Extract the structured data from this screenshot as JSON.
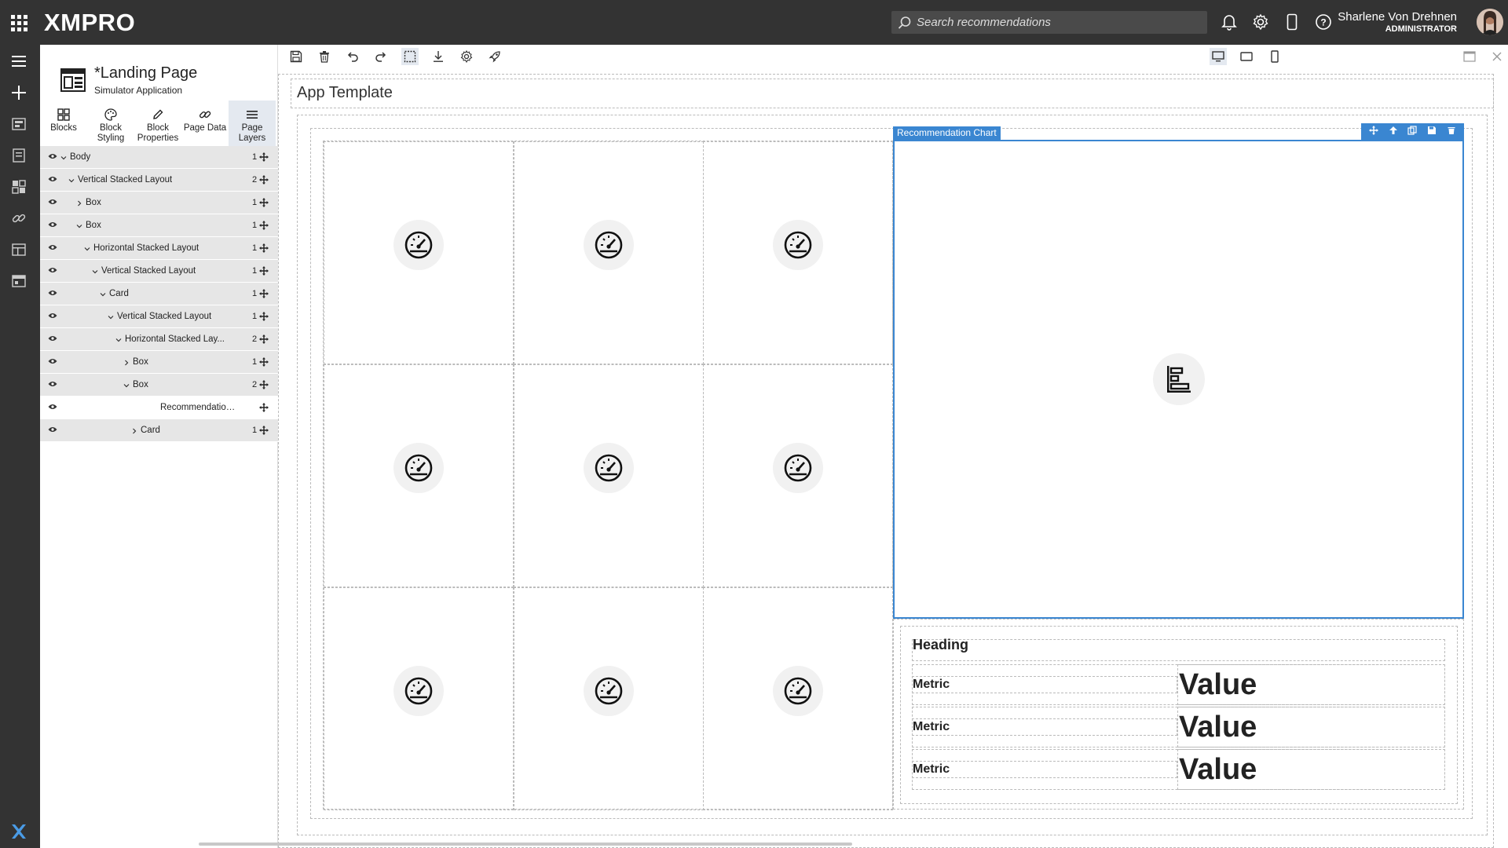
{
  "app": {
    "logo": "XMPRO",
    "search_placeholder": "Search recommendations"
  },
  "user": {
    "name": "Sharlene Von Drehnen",
    "role": "ADMINISTRATOR"
  },
  "page": {
    "title": "*Landing Page",
    "subtitle": "Simulator Application"
  },
  "panel_tabs": [
    {
      "label": "Blocks",
      "icon": "blocks-icon"
    },
    {
      "label": "Block Styling",
      "icon": "palette-icon"
    },
    {
      "label": "Block Properties",
      "icon": "pencil-icon"
    },
    {
      "label": "Page Data",
      "icon": "link-icon"
    },
    {
      "label": "Page Layers",
      "icon": "layers-icon",
      "active": true
    }
  ],
  "layers": [
    {
      "name": "Body",
      "count": "1",
      "chevron": "v"
    },
    {
      "name": "Vertical Stacked Layout",
      "count": "2",
      "chevron": "v"
    },
    {
      "name": "Box",
      "count": "1",
      "chevron": ">"
    },
    {
      "name": "Box",
      "count": "1",
      "chevron": "v"
    },
    {
      "name": "Horizontal Stacked Layout",
      "count": "1",
      "chevron": "v"
    },
    {
      "name": "Vertical Stacked Layout",
      "count": "1",
      "chevron": "v"
    },
    {
      "name": "Card",
      "count": "1",
      "chevron": "v"
    },
    {
      "name": "Vertical Stacked Layout",
      "count": "1",
      "chevron": "v"
    },
    {
      "name": "Horizontal Stacked Lay...",
      "count": "2",
      "chevron": "v"
    },
    {
      "name": "Box",
      "count": "1",
      "chevron": ">"
    },
    {
      "name": "Box",
      "count": "2",
      "chevron": "v"
    },
    {
      "name": "Recommendation C...",
      "count": "",
      "chevron": ""
    },
    {
      "name": "Card",
      "count": "1",
      "chevron": ">"
    }
  ],
  "canvas": {
    "template_title": "App Template",
    "chart_label": "Recommendation Chart",
    "card": {
      "heading": "Heading",
      "rows": [
        {
          "metric": "Metric",
          "value": "Value"
        },
        {
          "metric": "Metric",
          "value": "Value"
        },
        {
          "metric": "Metric",
          "value": "Value"
        }
      ]
    }
  }
}
